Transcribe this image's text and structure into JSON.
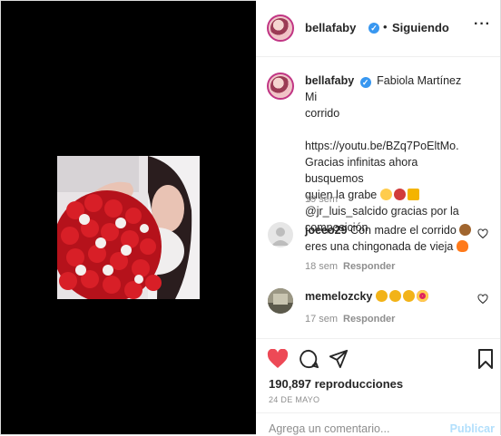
{
  "post": {
    "username": "bellafaby",
    "follow_separator": "•",
    "follow_label": "Siguiendo",
    "more_label": "···"
  },
  "caption": {
    "username": "bellafaby",
    "lines": [
      "Fabiola Martínez Mi",
      "corrido",
      "",
      "https://youtu.be/BZq7PoEltMo.",
      "Gracias infinitas ahora busquemos",
      "quien la grabe",
      "@jr_luis_salcido gracias por la",
      "composición"
    ],
    "time": "19 sem"
  },
  "comments": [
    {
      "username": "joeeo29",
      "text_line1": "Con madre el corrido",
      "text_line2": "eres una chingonada de vieja",
      "time": "18 sem",
      "reply": "Responder"
    },
    {
      "username": "memelozcky",
      "text_line1": "",
      "time": "17 sem",
      "reply": "Responder"
    }
  ],
  "stats": {
    "views": "190,897 reproducciones",
    "date": "24 DE MAYO"
  },
  "composer": {
    "placeholder": "Agrega un comentario...",
    "post_label": "Publicar"
  },
  "colors": {
    "like_red": "#ed4956",
    "verified_blue": "#3897f0",
    "link_disabled": "#b2dffc"
  }
}
